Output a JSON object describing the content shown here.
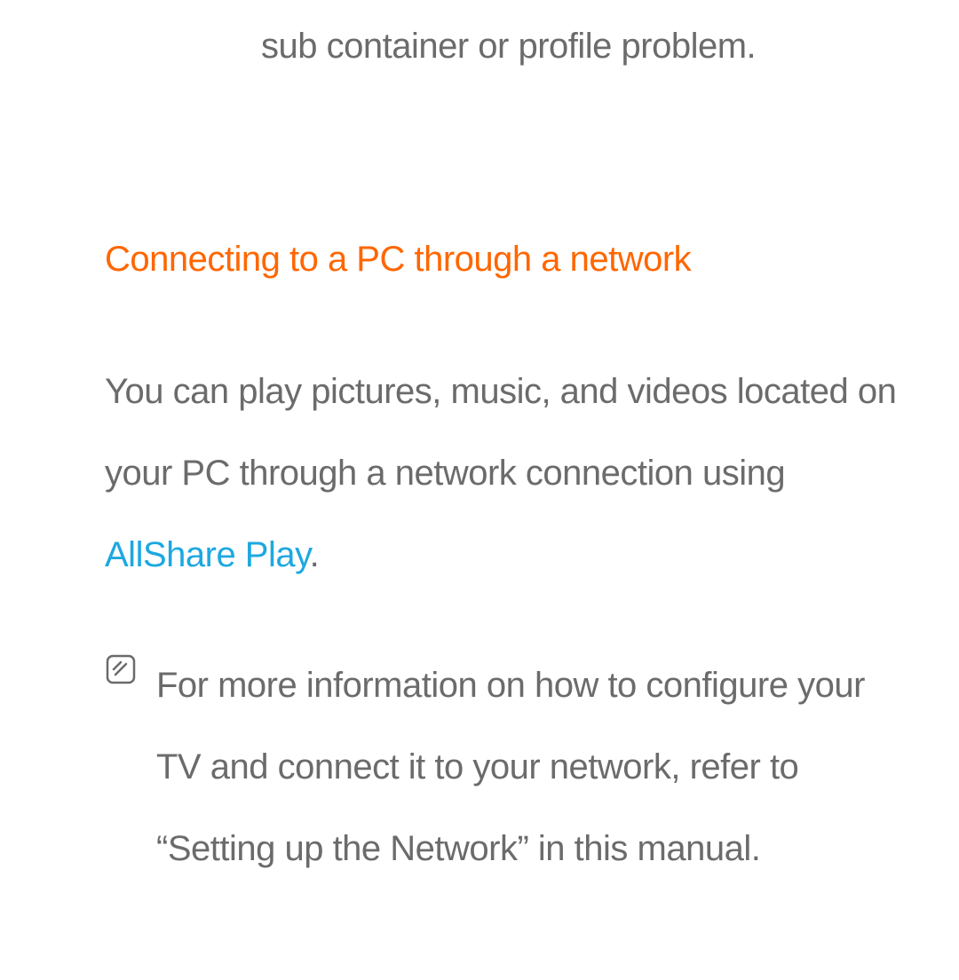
{
  "top_line": "sub container or profile problem.",
  "heading": "Connecting to a PC through a network",
  "paragraph_part1": "You can play pictures, music, and videos located on your PC through a network connection using ",
  "link_text": "AllShare Play",
  "paragraph_part2": ".",
  "note_text": "For more information on how to configure your TV and connect it to your network, refer to “Setting up the Network” in this manual."
}
